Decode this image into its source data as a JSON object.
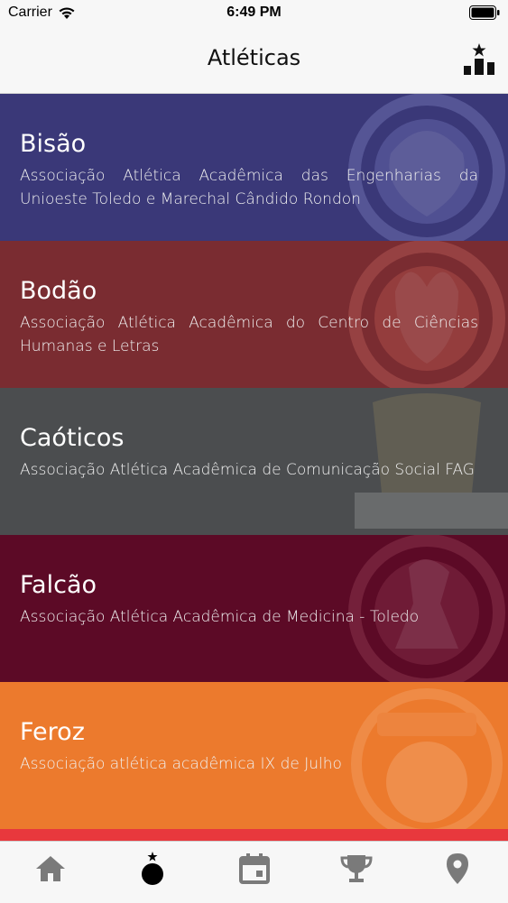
{
  "status_bar": {
    "carrier": "Carrier",
    "time": "6:49 PM"
  },
  "nav": {
    "title": "Atléticas",
    "ranking_icon": "podium-star-icon"
  },
  "rows": [
    {
      "name": "Bisão",
      "description": "Associação Atlética Acadêmica das Engenharias da Unioeste Toledo e Marechal Cândido Rondon",
      "color": "#3a3878",
      "crest": "bison-crest-icon"
    },
    {
      "name": "Bodão",
      "description": "Associação Atlética Acadêmica do Centro de Ciências Humanas e Letras",
      "color": "#7a2c31",
      "crest": "goat-crest-icon"
    },
    {
      "name": "Caóticos",
      "description": "Associação Atlética Acadêmica de Comunicação Social FAG",
      "color": "#4b4d4f",
      "crest": "caoticos-crest-icon"
    },
    {
      "name": "Falcão",
      "description": "Associação Atlética Acadêmica de Medicina - Toledo",
      "color": "#5c0a26",
      "crest": "falcon-crest-icon"
    },
    {
      "name": "Feroz",
      "description": "Associação atlética acadêmica IX de Julho",
      "color": "#ec7a2d",
      "crest": "jaguar-crest-icon"
    }
  ],
  "next_row_color": "#e8383d",
  "tabs": [
    {
      "name": "home-icon"
    },
    {
      "name": "ball-star-icon",
      "active": true
    },
    {
      "name": "calendar-icon"
    },
    {
      "name": "trophy-icon"
    },
    {
      "name": "location-pin-icon"
    }
  ]
}
